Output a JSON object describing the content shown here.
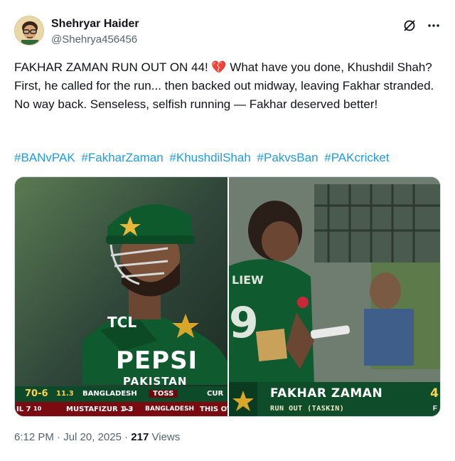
{
  "author": {
    "display_name": "Shehryar Haider",
    "handle": "@Shehrya456456"
  },
  "header_icons": [
    "grok-icon",
    "more-icon"
  ],
  "tweet": {
    "text": "FAKHAR ZAMAN RUN OUT ON 44! 💔 What have you done, Khushdil Shah? First, he called for the run... then backed out midway, leaving Fakhar stranded. No way back. Senseless, selfish running — Fakhar deserved better!",
    "hashtags": [
      "#BANvPAK",
      "#FakharZaman",
      "#KhushdilShah",
      "#PakvsBan",
      "#PAKcricket"
    ]
  },
  "media": {
    "left_image": {
      "jersey_sponsor_1": "TCL",
      "jersey_sponsor_2": "PEPSI",
      "jersey_country": "PAKISTAN",
      "scorebar": {
        "score": "70-6",
        "overs": "11.3",
        "team": "BANGLADESH",
        "toss_label": "TOSS",
        "toss_team": "BANGLADESH",
        "cur_label": "CUR",
        "target_line": "IL 7",
        "target_balls": "10",
        "bowler": "MUSTAFIZUR 1-3",
        "bowler_overs": "1.3",
        "this_over": "THIS OV"
      }
    },
    "right_image": {
      "player_name": "FAKHAR ZAMAN",
      "status": "RUN OUT (TASKIN)",
      "score_partial": "4",
      "trailing": "F"
    }
  },
  "meta": {
    "time": "6:12 PM",
    "separator": "·",
    "date": "Jul 20, 2025",
    "views_count": "217",
    "views_label": "Views"
  },
  "colors": {
    "link": "#1d9bf0",
    "secondary_text": "#536471",
    "primary_text": "#0f1419",
    "pak_green": "#0f4d2a",
    "ban_red": "#8b0d12"
  }
}
